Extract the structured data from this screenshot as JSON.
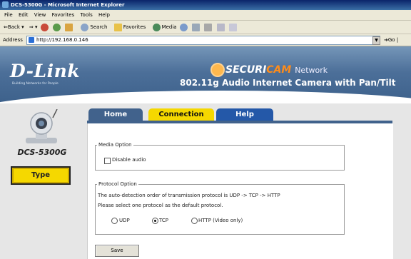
{
  "window": {
    "title": "DCS-5300G - Microsoft Internet Explorer"
  },
  "menu": [
    "File",
    "Edit",
    "View",
    "Favorites",
    "Tools",
    "Help"
  ],
  "toolbar": {
    "back": "Back",
    "search": "Search",
    "favorites": "Favorites",
    "media": "Media"
  },
  "address": {
    "label": "Address",
    "url": "http://192.168.0.146",
    "go": "Go"
  },
  "brand": {
    "logo": "D-Link",
    "tagline": "Building Networks for People",
    "securicam_1": "SECURI",
    "securicam_2": "CAM",
    "network": "Network",
    "product": "802.11g Audio Internet Camera with Pan/Tilt"
  },
  "sidebar": {
    "model": "DCS-5300G",
    "type_button": "Type"
  },
  "tabs": [
    {
      "label": "Home"
    },
    {
      "label": "Connection"
    },
    {
      "label": "Help"
    }
  ],
  "media_option": {
    "legend": "Media Option",
    "disable_audio": "Disable audio",
    "disable_audio_checked": false
  },
  "protocol_option": {
    "legend": "Protocol Option",
    "line1": "The auto-detection order of transmission protocol is UDP -> TCP -> HTTP",
    "line2": "Please select one protocol as the default protocol.",
    "options": [
      "UDP",
      "TCP",
      "HTTP (Video only)"
    ],
    "selected": "TCP"
  },
  "save_button": "Save",
  "colors": {
    "tab_active": "#f5d800",
    "header_blue": "#4c6f99",
    "securicam_orange": "#ff8c1a"
  }
}
